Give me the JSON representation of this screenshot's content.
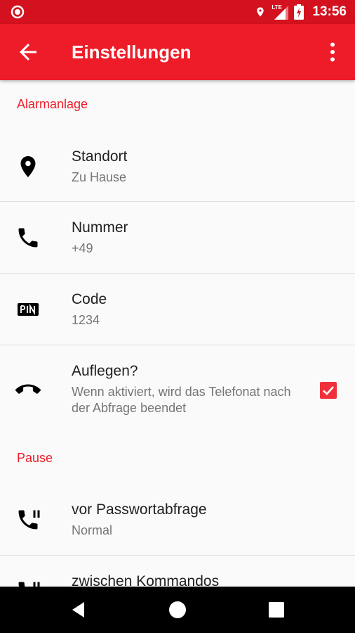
{
  "status_bar": {
    "time": "13:56",
    "network": "LTE"
  },
  "app_bar": {
    "title": "Einstellungen"
  },
  "sections": [
    {
      "header": "Alarmanlage"
    },
    {
      "header": "Pause"
    }
  ],
  "items": [
    {
      "title": "Standort",
      "subtitle": "Zu Hause",
      "icon": "location-pin-icon"
    },
    {
      "title": "Nummer",
      "subtitle": "+49",
      "icon": "phone-icon"
    },
    {
      "title": "Code",
      "subtitle": "1234",
      "icon": "pin-icon"
    },
    {
      "title": "Auflegen?",
      "subtitle": "Wenn aktiviert, wird das Telefonat nach der Abfrage beendet",
      "icon": "hang-up-icon",
      "checked": true
    },
    {
      "title": "vor Passwortabfrage",
      "subtitle": "Normal",
      "icon": "phone-paused-icon"
    },
    {
      "title": "zwischen Kommandos",
      "icon": "phone-paused-icon"
    }
  ],
  "colors": {
    "primary": "#ee1c28",
    "primary_dark": "#d4111e",
    "accent": "#f0303a"
  }
}
